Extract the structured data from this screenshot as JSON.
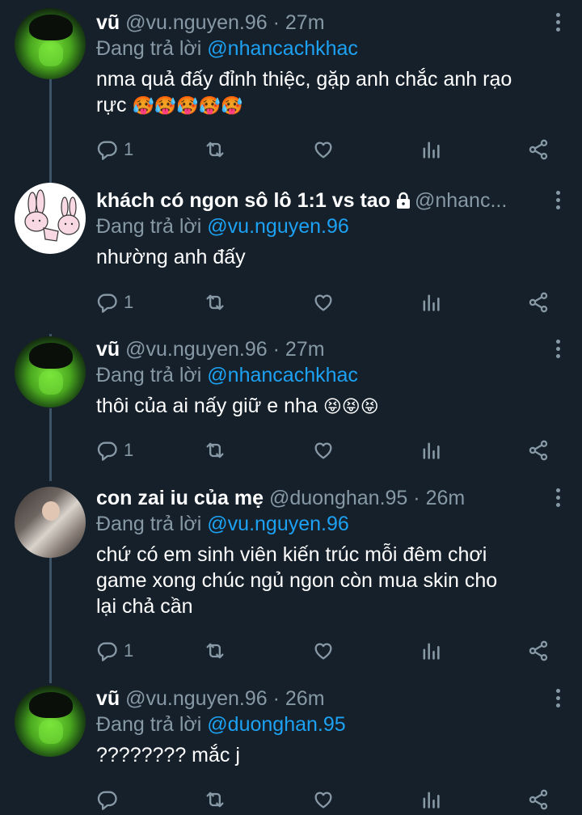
{
  "tweets": [
    {
      "name": "vũ",
      "handle": "@vu.nguyen.96",
      "separator": "·",
      "time": "27m",
      "reply_label": "Đang trả lời",
      "reply_to": "@nhancachkhac",
      "text_line1": "nma quả đấy đỉnh thiệc, gặp anh chắc anh rạo",
      "text_line2": "rực",
      "emoji": "🥵🥵🥵🥵🥵",
      "reply_count": "1",
      "avatar": "green-avatar"
    },
    {
      "name": "khách có ngon sô lô 1:1 vs tao",
      "handle": "@nhanc...",
      "reply_label": "Đang trả lời",
      "reply_to": "@vu.nguyen.96",
      "text_line1": "nhường anh đấy",
      "reply_count": "1",
      "avatar": "bunny-avatar"
    },
    {
      "name": "vũ",
      "handle": "@vu.nguyen.96",
      "separator": "·",
      "time": "27m",
      "reply_label": "Đang trả lời",
      "reply_to": "@nhancachkhac",
      "text_line1": "thôi của ai nấy giữ e nha",
      "emoji": "😝😝😝",
      "reply_count": "1",
      "avatar": "green-avatar"
    },
    {
      "name": "con zai iu của mẹ",
      "handle": "@duonghan.95",
      "separator": "·",
      "time": "26m",
      "reply_label": "Đang trả lời",
      "reply_to": "@vu.nguyen.96",
      "text_line1": "chứ có em sinh viên kiến trúc mỗi đêm chơi",
      "text_line2": "game xong chúc ngủ ngon còn mua skin cho",
      "text_line3": "lại chả cần",
      "reply_count": "1",
      "avatar": "photo-avatar"
    },
    {
      "name": "vũ",
      "handle": "@vu.nguyen.96",
      "separator": "·",
      "time": "26m",
      "reply_label": "Đang trả lời",
      "reply_to": "@duonghan.95",
      "text_line1": "???????? mắc j",
      "reply_count": "",
      "avatar": "green-avatar"
    }
  ],
  "icons": {
    "reply": "reply-icon",
    "retweet": "retweet-icon",
    "like": "heart-icon",
    "stats": "analytics-icon",
    "share": "share-icon",
    "more": "more-options-icon",
    "lock": "lock-icon"
  },
  "colors": {
    "background": "#15202b",
    "text": "#ffffff",
    "secondary": "#8899a6",
    "link": "#1da1f2",
    "thread_line": "#3d5466"
  }
}
